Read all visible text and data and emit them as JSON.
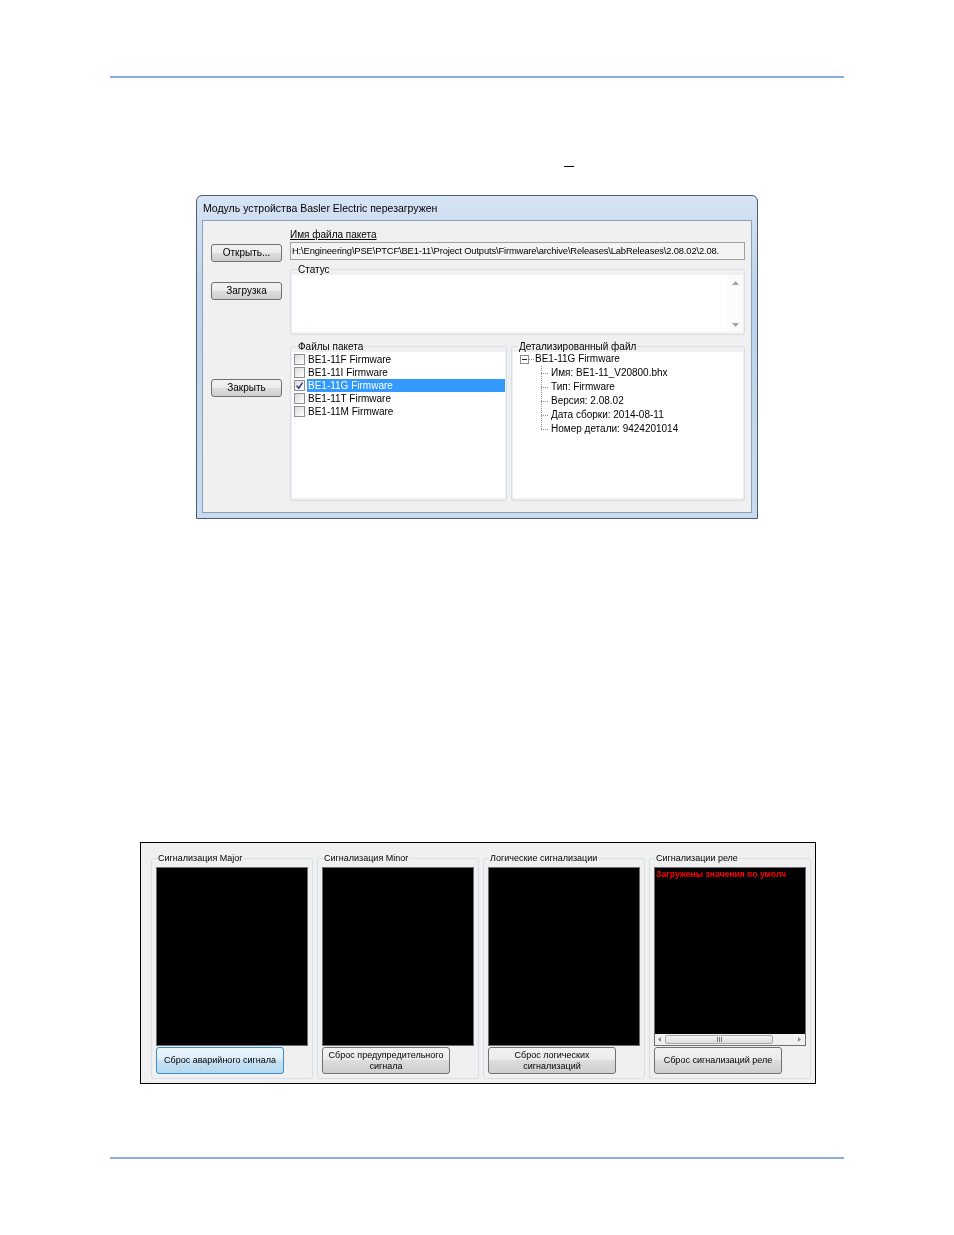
{
  "dialog": {
    "title": "Модуль устройства Basler Electric перезагружен",
    "buttons": [
      {
        "label": "Открыть..."
      },
      {
        "label": "Загрузка"
      },
      {
        "label": "Закрыть"
      }
    ],
    "package_file": {
      "label": "Имя файла пакета",
      "value": "H:\\Engineering\\PSE\\PTCF\\BE1-11\\Project Outputs\\Firmware\\archive\\Releases\\LabReleases\\2.08.02\\2.08."
    },
    "status": {
      "label": "Статус"
    },
    "package_files": {
      "label": "Файлы пакета",
      "items": [
        {
          "label": "BE1-11F Firmware",
          "checked": false,
          "selected": false
        },
        {
          "label": "BE1-11I Firmware",
          "checked": false,
          "selected": false
        },
        {
          "label": "BE1-11G Firmware",
          "checked": true,
          "selected": true
        },
        {
          "label": "BE1-11T Firmware",
          "checked": false,
          "selected": false
        },
        {
          "label": "BE1-11M Firmware",
          "checked": false,
          "selected": false
        }
      ]
    },
    "detailed_file": {
      "label": "Детализированный файл",
      "tree": [
        {
          "label": "BE1-11G Firmware",
          "expanded": true,
          "children": [
            {
              "label": "Имя: BE1-11_V20800.bhx"
            },
            {
              "label": "Тип: Firmware"
            },
            {
              "label": "Версия: 2.08.02"
            },
            {
              "label": "Дата сборки: 2014-08-11"
            },
            {
              "label": "Номер детали: 9424201014"
            }
          ]
        }
      ]
    }
  },
  "alarm_panel": {
    "groups": [
      {
        "title": "Сигнализация Major",
        "button": {
          "label": "Сброс аварийного сигнала",
          "focused": true
        }
      },
      {
        "title": "Сигнализация Minor",
        "button": {
          "label": "Сброс предупредительного сигнала",
          "focused": false
        }
      },
      {
        "title": "Логические сигнализации",
        "button": {
          "label": "Сброс логических сигнализаций",
          "focused": false
        }
      },
      {
        "title": "Сигнализации реле",
        "messages": [
          "Загружены значения по умолч"
        ],
        "button": {
          "label": "Сброс сигнализаций реле",
          "focused": false
        }
      }
    ]
  }
}
